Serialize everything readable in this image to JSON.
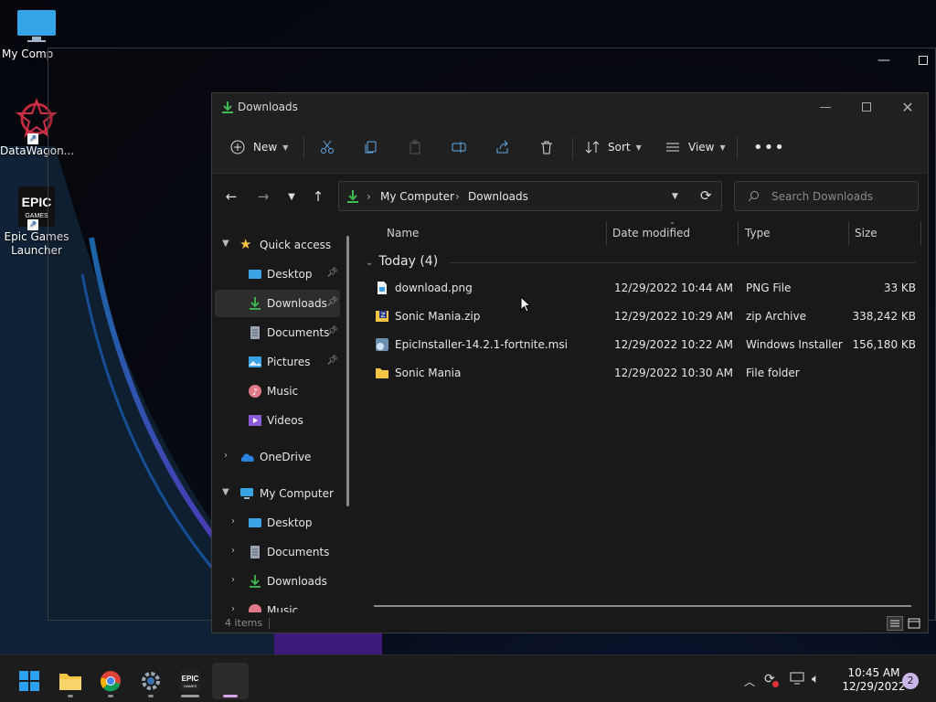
{
  "desktop": {
    "icons": [
      {
        "label": "My Comp"
      },
      {
        "label": "DataWagon..."
      },
      {
        "label": "Epic Games Launcher"
      }
    ]
  },
  "window": {
    "title": "Downloads",
    "toolbar": {
      "new_label": "New",
      "sort_label": "Sort",
      "view_label": "View"
    },
    "address": {
      "crumbs": [
        "My Computer",
        "Downloads"
      ]
    },
    "search": {
      "placeholder": "Search Downloads"
    },
    "sidebar": {
      "quick_access": "Quick access",
      "quick_items": [
        "Desktop",
        "Downloads",
        "Documents",
        "Pictures",
        "Music",
        "Videos"
      ],
      "onedrive": "OneDrive",
      "my_computer": "My Computer",
      "pc_items": [
        "Desktop",
        "Documents",
        "Downloads",
        "Music"
      ]
    },
    "columns": {
      "name": "Name",
      "date": "Date modified",
      "type": "Type",
      "size": "Size"
    },
    "group_label": "Today (4)",
    "files": [
      {
        "name": "download.png",
        "date": "12/29/2022 10:44 AM",
        "type": "PNG File",
        "size": "33 KB",
        "icon": "image-file-icon"
      },
      {
        "name": "Sonic Mania.zip",
        "date": "12/29/2022 10:29 AM",
        "type": "zip Archive",
        "size": "338,242 KB",
        "icon": "zip-file-icon"
      },
      {
        "name": "EpicInstaller-14.2.1-fortnite.msi",
        "date": "12/29/2022 10:22 AM",
        "type": "Windows Installer ...",
        "size": "156,180 KB",
        "icon": "msi-file-icon"
      },
      {
        "name": "Sonic Mania",
        "date": "12/29/2022 10:30 AM",
        "type": "File folder",
        "size": "",
        "icon": "folder-icon"
      }
    ],
    "status": "4 items"
  },
  "taskbar": {
    "time": "10:45 AM",
    "date": "12/29/2022",
    "notifications": "2"
  },
  "colors": {
    "accent_green": "#3fb950",
    "folder_yellow": "#f4c542",
    "selection": "#2d2d2d"
  }
}
